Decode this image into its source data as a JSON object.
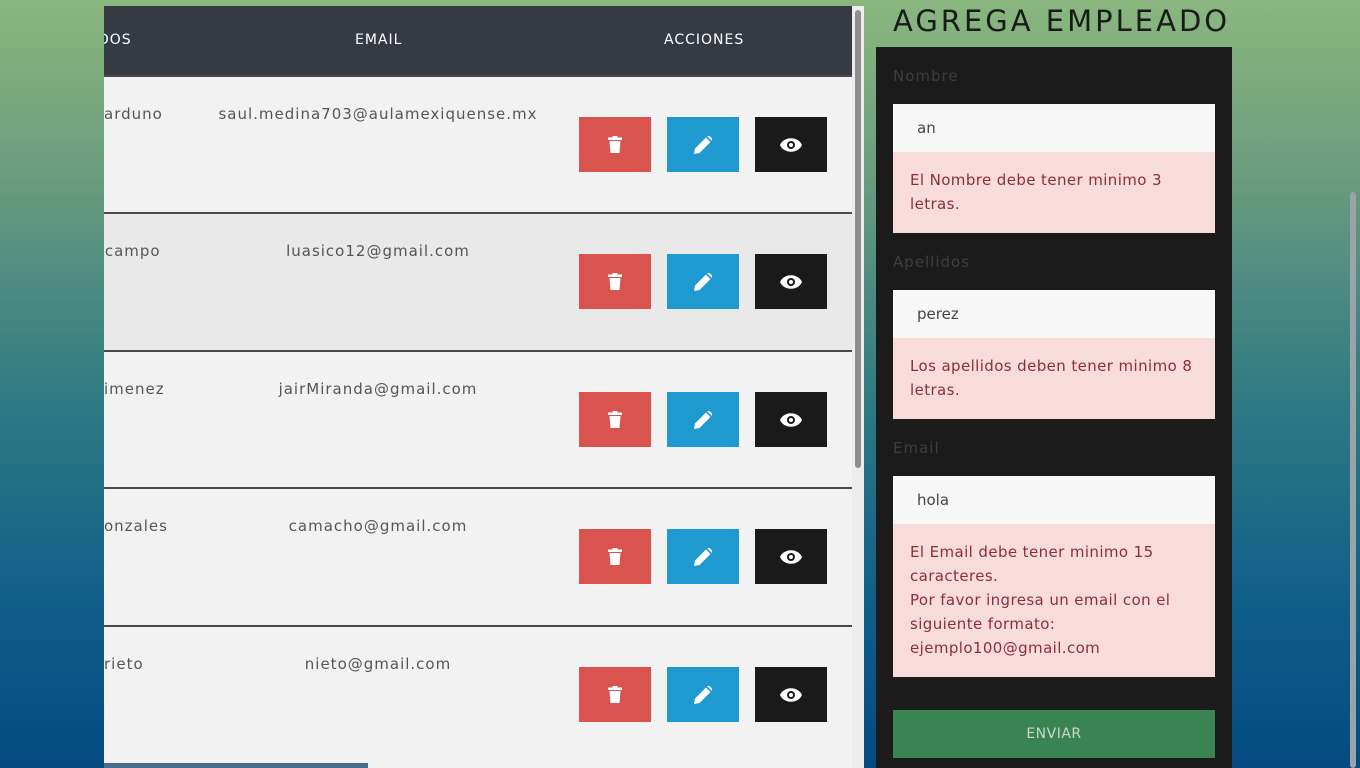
{
  "table": {
    "headers": {
      "apellidos": "DOS",
      "email": "EMAIL",
      "acciones": "ACCIONES"
    },
    "rows": [
      {
        "apellido": "arduno",
        "email": "saul.medina703@aulamexiquense.mx"
      },
      {
        "apellido": ")campo",
        "email": "luasico12@gmail.com"
      },
      {
        "apellido": "imenez",
        "email": "jairMiranda@gmail.com"
      },
      {
        "apellido": "onzales",
        "email": "camacho@gmail.com"
      },
      {
        "apellido": "rieto",
        "email": "nieto@gmail.com"
      }
    ],
    "action_icons": [
      "trash-icon",
      "pencil-icon",
      "eye-icon"
    ]
  },
  "form": {
    "title": "AGREGA EMPLEADO",
    "nombre": {
      "label": "Nombre",
      "value": "an",
      "error": "El Nombre debe tener minimo 3 letras."
    },
    "apellidos": {
      "label": "Apellidos",
      "value": "perez",
      "error": "Los apellidos deben tener minimo 8 letras."
    },
    "email": {
      "label": "Email",
      "value": "hola",
      "error_1": "El Email debe tener minimo 15 caracteres.",
      "error_2": "Por favor ingresa un email con el siguiente formato: ejemplo100@gmail.com"
    },
    "submit_label": "ENVIAR"
  },
  "colors": {
    "delete": "#d9534f",
    "edit": "#1e9ad1",
    "view": "#1a1a1a",
    "submit": "#3a8453",
    "error_bg": "#f8dcdc",
    "header_bg": "#353a43"
  }
}
